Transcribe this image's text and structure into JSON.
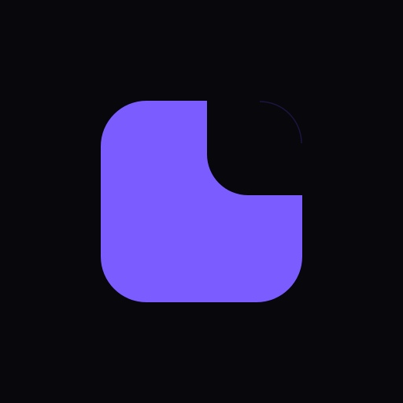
{
  "logo": {
    "icon": "rounded-square-notched-corner-icon",
    "colors": {
      "background": "#07070c",
      "shape": "#7b5cff",
      "corner_outline": "#1c1540"
    }
  }
}
